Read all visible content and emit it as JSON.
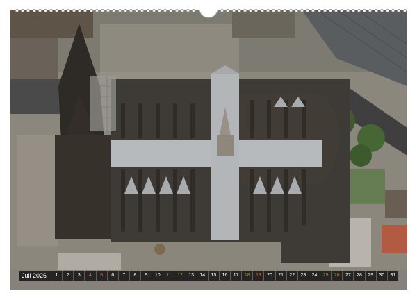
{
  "calendar": {
    "month_label": "Juli 2026",
    "days": [
      {
        "n": "1",
        "weekend": false
      },
      {
        "n": "2",
        "weekend": false
      },
      {
        "n": "3",
        "weekend": false
      },
      {
        "n": "4",
        "weekend": true
      },
      {
        "n": "5",
        "weekend": true
      },
      {
        "n": "6",
        "weekend": false
      },
      {
        "n": "7",
        "weekend": false
      },
      {
        "n": "8",
        "weekend": false
      },
      {
        "n": "9",
        "weekend": false
      },
      {
        "n": "10",
        "weekend": false
      },
      {
        "n": "11",
        "weekend": true
      },
      {
        "n": "12",
        "weekend": true
      },
      {
        "n": "13",
        "weekend": false
      },
      {
        "n": "14",
        "weekend": false
      },
      {
        "n": "15",
        "weekend": false
      },
      {
        "n": "16",
        "weekend": false
      },
      {
        "n": "17",
        "weekend": false
      },
      {
        "n": "18",
        "weekend": true
      },
      {
        "n": "19",
        "weekend": true
      },
      {
        "n": "20",
        "weekend": false
      },
      {
        "n": "21",
        "weekend": false
      },
      {
        "n": "22",
        "weekend": false
      },
      {
        "n": "23",
        "weekend": false
      },
      {
        "n": "24",
        "weekend": false
      },
      {
        "n": "25",
        "weekend": true
      },
      {
        "n": "26",
        "weekend": true
      },
      {
        "n": "27",
        "weekend": false
      },
      {
        "n": "28",
        "weekend": false
      },
      {
        "n": "29",
        "weekend": false
      },
      {
        "n": "30",
        "weekend": false
      },
      {
        "n": "31",
        "weekend": false
      }
    ],
    "weekend_color": "#ff5a4e"
  },
  "photo": {
    "subject": "cathedral-aerial-view"
  }
}
